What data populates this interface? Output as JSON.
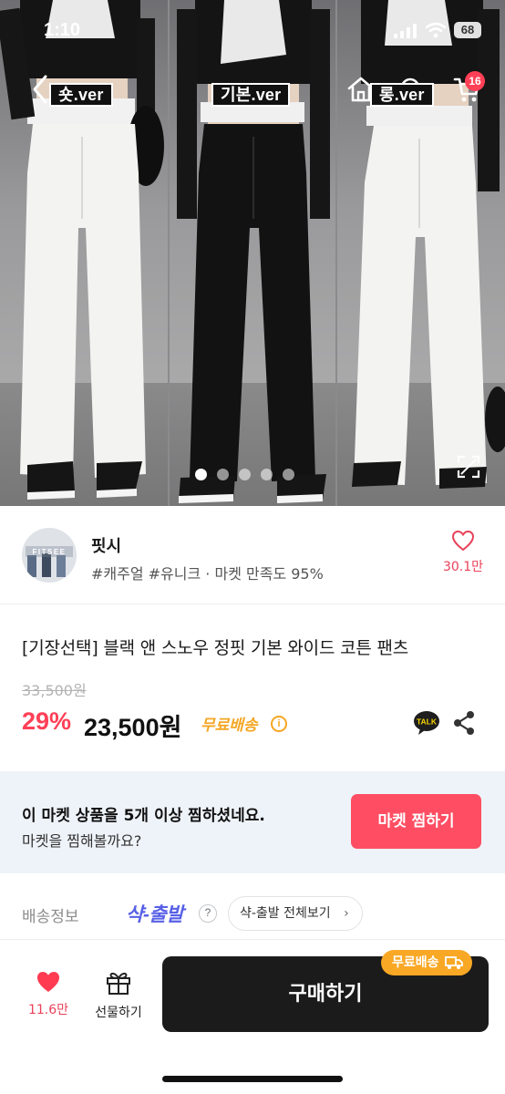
{
  "status_bar": {
    "time": "1:10",
    "battery": "68"
  },
  "hero": {
    "tags": [
      "숏.ver",
      "기본.ver",
      "롱.ver"
    ],
    "cart_count": "16",
    "slide_count": 5,
    "active_slide": 1
  },
  "seller": {
    "avatar_text": "FITSEE",
    "name": "핏시",
    "tags": "#캐주얼 #유니크 · 마켓 만족도 95%",
    "likes": "30.1만"
  },
  "product": {
    "title": "[기장선택] 블랙 앤 스노우 정핏 기본 와이드 코튼 팬츠",
    "original_price": "33,500원",
    "discount": "29%",
    "price": "23,500원",
    "free_shipping": "무료배송",
    "talk_label": "TALK"
  },
  "banner": {
    "main": "이 마켓 상품을 5개 이상 찜하셨네요.",
    "sub": "마켓을 찜해볼까요?",
    "button": "마켓 찜하기"
  },
  "shipping": {
    "label": "배송정보",
    "brand": "샥-출발",
    "link": "샥-출발 전체보기"
  },
  "bottom": {
    "wish_count": "11.6만",
    "gift_label": "선물하기",
    "buy_label": "구매하기",
    "buy_badge": "무료배송"
  },
  "colors": {
    "accent": "#ff4056",
    "free_shipping": "#f5a623",
    "banner_bg": "#eef3f9",
    "buy_button": "#1b1b1b",
    "brand_blue": "#5860e6"
  }
}
